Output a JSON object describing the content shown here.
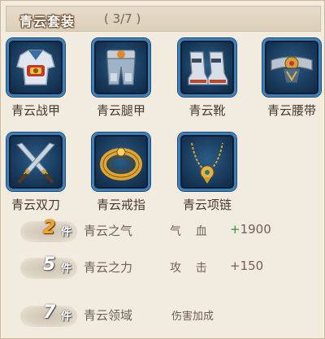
{
  "set": {
    "title": "青云套装",
    "count": "( 3/7 )"
  },
  "items": [
    {
      "name": "青云战甲",
      "icon": "armor-icon"
    },
    {
      "name": "青云腿甲",
      "icon": "leg-armor-icon"
    },
    {
      "name": "青云靴",
      "icon": "boots-icon"
    },
    {
      "name": "青云腰带",
      "icon": "belt-icon"
    },
    {
      "name": "青云双刀",
      "icon": "twin-blades-icon"
    },
    {
      "name": "青云戒指",
      "icon": "ring-icon"
    },
    {
      "name": "青云项链",
      "icon": "necklace-icon"
    }
  ],
  "bonuses": [
    {
      "pieces": "2",
      "unit": "件",
      "name": "青云之气",
      "stat": "气    血",
      "plus": "+",
      "value": "1900",
      "active": true
    },
    {
      "pieces": "5",
      "unit": "件",
      "name": "青云之力",
      "stat": "攻    击",
      "plus": "+",
      "value": "150",
      "active": false
    },
    {
      "pieces": "7",
      "unit": "件",
      "name": "青云领域",
      "stat": "伤害加成",
      "plus": "",
      "value": "",
      "active": false
    }
  ],
  "colors": {
    "active_pieces": "#f6a323",
    "plus_green": "#2a9a2a",
    "slot_border": "#3c7fb8"
  }
}
